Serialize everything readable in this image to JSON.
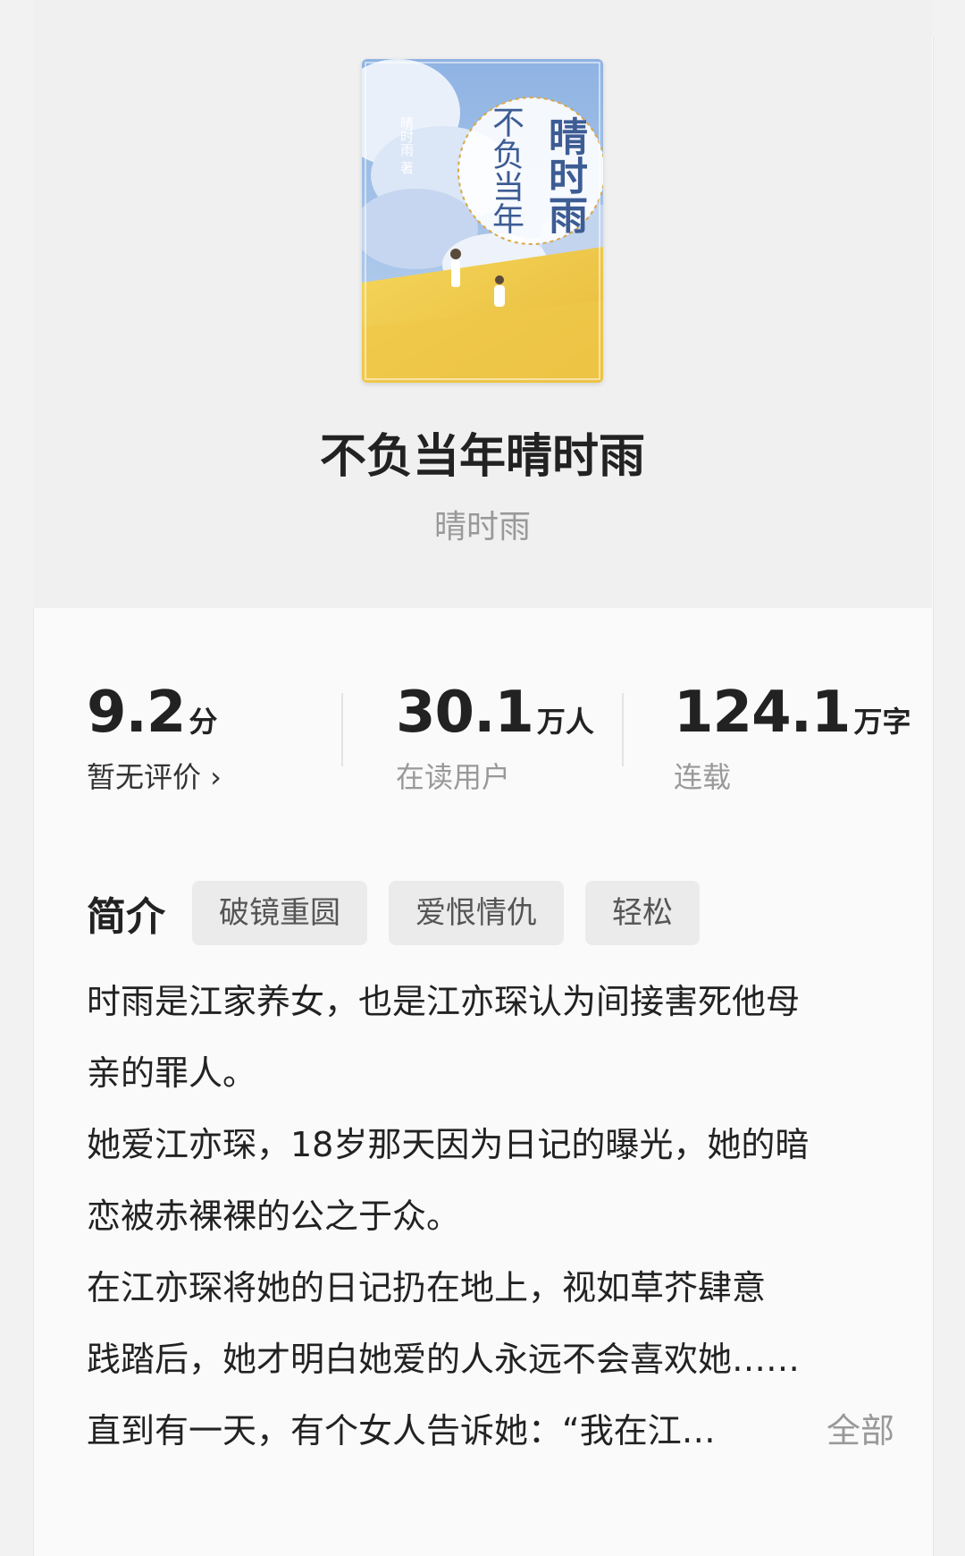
{
  "book": {
    "title": "不负当年晴时雨",
    "author": "晴时雨",
    "cover": {
      "title_main": "晴时雨",
      "title_sub": "不负当年",
      "author": "晴时雨 著"
    }
  },
  "stats": {
    "rating": {
      "value": "9.2",
      "unit": "分",
      "sub": "暂无评价 ›"
    },
    "readers": {
      "value": "30.1",
      "unit": "万人",
      "sub": "在读用户"
    },
    "words": {
      "value": "124.1",
      "unit": "万字",
      "sub": "连载"
    }
  },
  "intro": {
    "label": "简介",
    "tags": [
      "破镜重圆",
      "爱恨情仇",
      "轻松"
    ],
    "lines": [
      "时雨是江家养女，也是江亦琛认为间接害死他母",
      "亲的罪人。",
      "她爱江亦琛，18岁那天因为日记的曝光，她的暗",
      "恋被赤裸裸的公之于众。",
      " 在江亦琛将她的日记扔在地上，视如草芥肆意",
      "践踏后，她才明白她爱的人永远不会喜欢她……",
      "直到有一天，有个女人告诉她：“我在江…"
    ],
    "more_label": "全部"
  },
  "colors": {
    "background": "#f2f2f2",
    "text_primary": "#222222",
    "text_secondary": "#999999",
    "tag_bg": "#ebebeb"
  }
}
